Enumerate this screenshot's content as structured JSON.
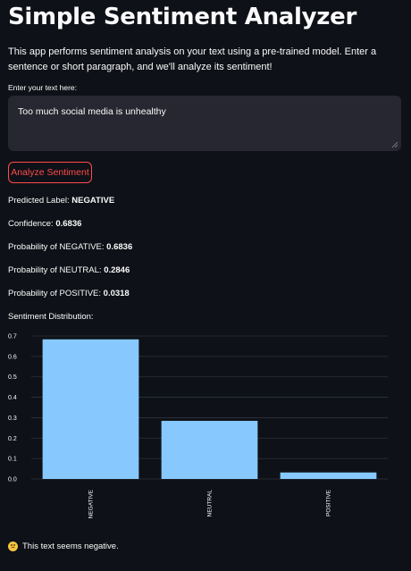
{
  "app": {
    "title": "Simple Sentiment Analyzer",
    "description": "This app performs sentiment analysis on your text using a pre-trained model. Enter a sentence or short paragraph, and we'll analyze its sentiment!"
  },
  "input": {
    "label": "Enter your text here:",
    "value": "Too much social media is unhealthy"
  },
  "button": {
    "label": "Analyze Sentiment",
    "color": "#ff4b4b"
  },
  "results": [
    {
      "label": "Predicted Label: ",
      "value": "NEGATIVE"
    },
    {
      "label": "Confidence: ",
      "value": "0.6836"
    },
    {
      "label": "Probability of NEGATIVE: ",
      "value": "0.6836"
    },
    {
      "label": "Probability of NEUTRAL: ",
      "value": "0.2846"
    },
    {
      "label": "Probability of POSITIVE: ",
      "value": "0.0318"
    }
  ],
  "distribution_label": "Sentiment Distribution:",
  "chart_data": {
    "type": "bar",
    "categories": [
      "NEGATIVE",
      "NEUTRAL",
      "POSITIVE"
    ],
    "values": [
      0.6836,
      0.2846,
      0.0318
    ],
    "yticks": [
      "0.0",
      "0.1",
      "0.2",
      "0.3",
      "0.4",
      "0.5",
      "0.6",
      "0.7"
    ],
    "ylim": [
      0,
      0.7
    ],
    "grid": true,
    "bar_color": "#87c9ff",
    "grid_color": "#2e323d"
  },
  "footer": {
    "emoji_icon": "disappointed-face-icon",
    "text": "This text seems negative."
  }
}
